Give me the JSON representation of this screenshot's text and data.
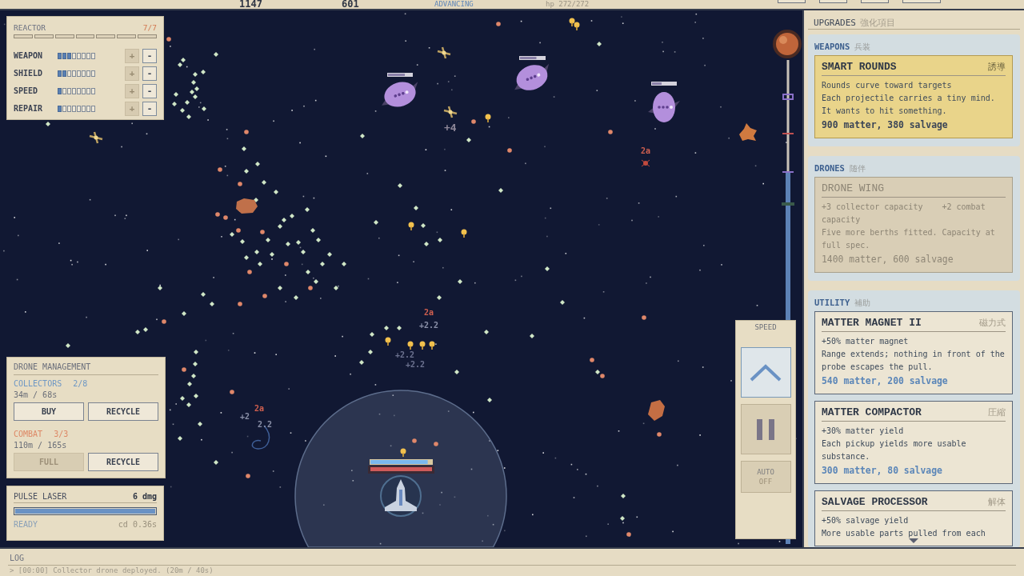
{
  "top_bar": {
    "stats": [
      {
        "text": "1147",
        "kind": "value"
      },
      {
        "text": "601",
        "kind": "value"
      },
      {
        "text": "ADVANCING",
        "kind": "status"
      },
      {
        "text": "hp 272/272",
        "kind": "muted"
      }
    ],
    "buttons": [
      {
        "kind": "small"
      },
      {
        "kind": "small"
      },
      {
        "kind": "small"
      },
      {
        "kind": "wide"
      }
    ]
  },
  "reactor": {
    "title": "REACTOR",
    "capacity": "7/7",
    "cells": [
      {
        "filled": false
      },
      {
        "filled": false
      },
      {
        "filled": false
      },
      {
        "filled": false
      },
      {
        "filled": false
      },
      {
        "filled": false
      },
      {
        "filled": false
      }
    ],
    "systems": [
      {
        "name": "WEAPON",
        "pips": [
          {
            "filled": true
          },
          {
            "filled": true
          },
          {
            "filled": true
          },
          {
            "filled": false
          },
          {
            "filled": false
          },
          {
            "filled": false
          },
          {
            "filled": false
          },
          {
            "filled": false
          }
        ],
        "increase": {
          "label": "+",
          "disabled": true
        },
        "decrease": {
          "label": "-",
          "disabled": false
        }
      },
      {
        "name": "SHIELD",
        "pips": [
          {
            "filled": true
          },
          {
            "filled": true
          },
          {
            "filled": false
          },
          {
            "filled": false
          },
          {
            "filled": false
          },
          {
            "filled": false
          },
          {
            "filled": false
          },
          {
            "filled": false
          }
        ],
        "increase": {
          "label": "+",
          "disabled": true
        },
        "decrease": {
          "label": "-",
          "disabled": false
        }
      },
      {
        "name": "SPEED",
        "pips": [
          {
            "filled": true
          },
          {
            "filled": false
          },
          {
            "filled": false
          },
          {
            "filled": false
          },
          {
            "filled": false
          },
          {
            "filled": false
          },
          {
            "filled": false
          },
          {
            "filled": false
          }
        ],
        "increase": {
          "label": "+",
          "disabled": true
        },
        "decrease": {
          "label": "-",
          "disabled": false
        }
      },
      {
        "name": "REPAIR",
        "pips": [
          {
            "filled": true
          },
          {
            "filled": false
          },
          {
            "filled": false
          },
          {
            "filled": false
          },
          {
            "filled": false
          },
          {
            "filled": false
          },
          {
            "filled": false
          },
          {
            "filled": false
          }
        ],
        "increase": {
          "label": "+",
          "disabled": true
        },
        "decrease": {
          "label": "-",
          "disabled": false
        }
      }
    ]
  },
  "drone_management": {
    "title": "DRONE MANAGEMENT",
    "groups": [
      {
        "name": "COLLECTORS",
        "count": "2/8",
        "color": "#6f98c4",
        "cost": "34m / 68s",
        "buttons": [
          {
            "label": "BUY",
            "disabled": false
          },
          {
            "label": "RECYCLE",
            "disabled": false
          }
        ]
      },
      {
        "name": "COMBAT",
        "count": "3/3",
        "color": "#dd8866",
        "cost": "110m / 165s",
        "buttons": [
          {
            "label": "FULL",
            "disabled": true
          },
          {
            "label": "RECYCLE",
            "disabled": false
          }
        ]
      }
    ]
  },
  "weapon": {
    "name": "PULSE LASER",
    "damage": "6 dmg",
    "charge": {
      "level": 1
    },
    "status": "READY",
    "cooldown": "cd 0.36s"
  },
  "speed_control": {
    "title": "SPEED",
    "buttons": [
      {
        "kind": "up",
        "selected": true
      },
      {
        "kind": "pause",
        "selected": false
      },
      {
        "kind": "auto",
        "label": "AUTO",
        "value": "OFF",
        "on": false
      }
    ]
  },
  "route": {
    "progress": {
      "level": 0.77
    }
  },
  "field": {
    "enemies": [
      {
        "health": {
          "level": 0.7
        }
      },
      {
        "health": {
          "level": 0.66
        }
      },
      {
        "health": {
          "level": 0.4
        }
      }
    ],
    "player": {
      "shield": {
        "level": 0.93
      },
      "hull": {
        "level": 1
      }
    },
    "floating_texts": [
      {
        "text": "+4",
        "color": "#8e8798"
      },
      {
        "text": "2a",
        "color": "#cf5f4f"
      },
      {
        "text": "2a",
        "color": "#cf5f4f"
      },
      {
        "text": "+2.2",
        "color": "#8a90a8"
      },
      {
        "text": "+2.2",
        "color": "#6c7290"
      },
      {
        "text": "+2.2",
        "color": "#6c7290"
      },
      {
        "text": "2a",
        "color": "#cf5f4f"
      },
      {
        "text": "+2",
        "color": "#8a90a8"
      },
      {
        "text": "2.2",
        "color": "#8a90a8"
      }
    ]
  },
  "upgrades": {
    "title": "UPGRADES",
    "subtitle": "強化項目",
    "sections": [
      {
        "name": "WEAPONS",
        "subtitle": "兵装",
        "items": [
          {
            "title": "SMART ROUNDS",
            "tag": "誘導",
            "effects": [
              "Rounds curve toward targets"
            ],
            "description": "Each projectile carries a tiny mind. It wants to hit something.",
            "cost": "900 matter, 380 salvage",
            "highlighted": true,
            "disabled": false
          }
        ]
      },
      {
        "name": "DRONES",
        "subtitle": "随伴",
        "items": [
          {
            "title": "DRONE WING",
            "effects": [
              "+3 collector capacity",
              "+2 combat capacity"
            ],
            "description": "Five more berths fitted. Capacity at full spec.",
            "cost": "1400 matter, 600 salvage",
            "highlighted": false,
            "disabled": true
          }
        ]
      },
      {
        "name": "UTILITY",
        "subtitle": "補助",
        "items": [
          {
            "title": "MATTER MAGNET II",
            "tag": "磁力式",
            "effects": [
              "+50% matter magnet"
            ],
            "description": "Range extends; nothing in front of the probe escapes the pull.",
            "cost": "540 matter, 200 salvage",
            "highlighted": false,
            "disabled": false
          },
          {
            "title": "MATTER COMPACTOR",
            "tag": "圧縮",
            "effects": [
              "+30% matter yield"
            ],
            "description": "Each pickup yields more usable substance.",
            "cost": "300 matter, 80 salvage",
            "highlighted": false,
            "disabled": false
          },
          {
            "title": "SALVAGE PROCESSOR",
            "tag": "解体",
            "effects": [
              "+50% salvage yield"
            ],
            "description": "More usable parts pulled from each",
            "highlighted": false,
            "disabled": false
          }
        ]
      }
    ]
  },
  "log": {
    "title": "LOG",
    "entries": [
      "> [00:00] Collector drone deployed. (20m / 40s)"
    ]
  }
}
